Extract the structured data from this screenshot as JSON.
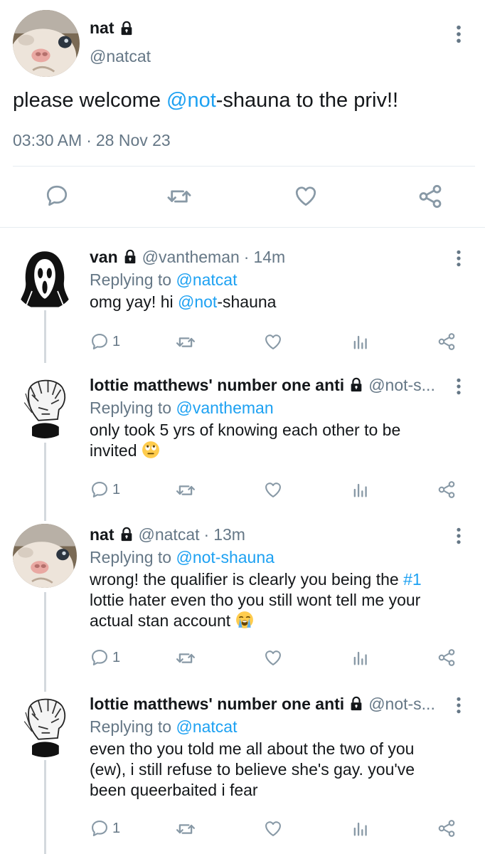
{
  "main_tweet": {
    "name": "nat",
    "handle": "@natcat",
    "text_before": "please welcome ",
    "mention_blue": "@not",
    "text_after": "-shauna to the priv!!",
    "time": "03:30 AM",
    "dot": "·",
    "date": "28 Nov 23",
    "icons": [
      "lock-icon",
      "more-vertical-icon",
      "reply-icon",
      "retweet-icon",
      "like-icon",
      "share-icon"
    ]
  },
  "replies": [
    {
      "name": "van",
      "handle": "@vantheman",
      "dot": "·",
      "time": "14m",
      "replying_to_label": "Replying to",
      "replying_to_handle": "@natcat",
      "text_parts": [
        "omg yay! hi ",
        "@not",
        "-shauna"
      ],
      "reply_count": "1"
    },
    {
      "name": "lottie matthews' number one anti",
      "handle": "@not-s...",
      "replying_to_label": "Replying to",
      "replying_to_handle": "@vantheman",
      "text_line1": "only took 5 yrs of knowing each other to be",
      "text_line2": "invited",
      "emoji": "face-with-rolling-eyes",
      "reply_count": "1"
    },
    {
      "name": "nat",
      "handle": "@natcat",
      "dot": "·",
      "time": "13m",
      "replying_to_label": "Replying to",
      "replying_to_handle": "@not-shauna",
      "text_line1_a": "wrong! the qualifier is clearly you being the ",
      "text_line1_hashtag": "#1",
      "text_line2": "lottie hater even tho you still wont tell me your",
      "text_line3": "actual stan account",
      "emoji": "loudly-crying-face",
      "reply_count": "1"
    },
    {
      "name": "lottie matthews' number one anti",
      "handle": "@not-s...",
      "replying_to_label": "Replying to",
      "replying_to_handle": "@natcat",
      "text_line1": "even tho you told me all about the two of you",
      "text_line2": "(ew), i still refuse to believe she's gay. you've",
      "text_line3": "been queerbaited i fear",
      "reply_count": "1"
    }
  ],
  "colors": {
    "link_blue": "#1da1f2",
    "secondary_gray": "#657786",
    "thread_line": "#d4d9de",
    "divider": "#e6ecf0",
    "action_icon_gray": "#8899a6"
  }
}
